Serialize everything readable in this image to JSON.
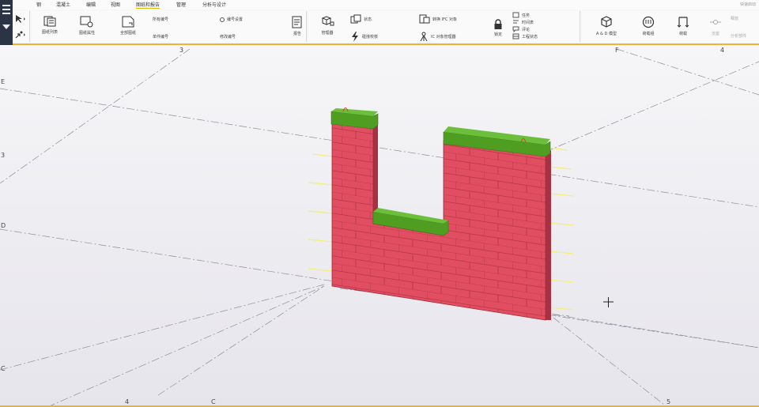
{
  "ribbon_tabs": [
    "钢",
    "混凝土",
    "编辑",
    "视图",
    "图纸和报告",
    "管理",
    "分析与设计"
  ],
  "active_tab": "图纸和报告",
  "search_placeholder": "快速启动",
  "ribbon": {
    "drawings": {
      "drawing_list": "图纸列表",
      "drawing_properties": "图纸属性",
      "general_drawing": "全部图纸",
      "mark_single": "单件编号",
      "mark_single_x": "所有编号",
      "mark_assembly": "编号设置",
      "mark_modified": "修改编号",
      "reports": "报告"
    },
    "management": {
      "organizer": "管理器",
      "status": "状态",
      "clash_check": "碰撞校核",
      "sync_ifc": "转换 IFC 对象",
      "ifc_management": "IC 对象管理器",
      "lock": "锁定",
      "tasks": "任务",
      "scheduler": "时间表",
      "comments": "评论",
      "project_status": "工程状态"
    },
    "analysis": {
      "ad_model": "A & D 模型",
      "load_groups": "荷载组",
      "loads": "荷载",
      "support": "支座",
      "release": "释放",
      "analysis_part": "分析部件"
    }
  },
  "grid_labels": {
    "top_3": "3",
    "top_F": "F",
    "top_4": "4",
    "left_E": "E",
    "left_3": "3",
    "left_D": "D",
    "left_C": "C",
    "bottom_4": "4",
    "bottom_C": "C",
    "bottom_5": "5"
  },
  "colors": {
    "brick": "#e24e61",
    "brick_side": "#a83040",
    "mortar": "#b33547",
    "top_cap": "#4f9e22",
    "accent": "#f0b232",
    "menu_bg": "#2b3444"
  }
}
